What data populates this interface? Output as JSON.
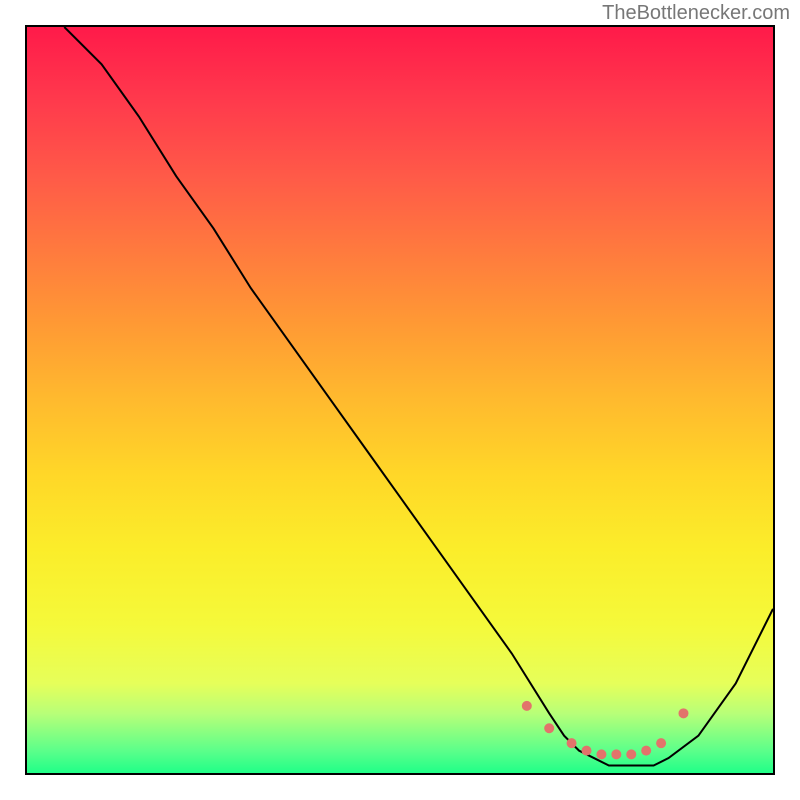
{
  "attribution": "TheBottlenecker.com",
  "chart_data": {
    "type": "line",
    "title": "",
    "xlabel": "",
    "ylabel": "",
    "xlim": [
      0,
      100
    ],
    "ylim": [
      0,
      100
    ],
    "series": [
      {
        "name": "bottleneck-curve",
        "x": [
          5,
          10,
          15,
          20,
          25,
          30,
          35,
          40,
          45,
          50,
          55,
          60,
          65,
          70,
          72,
          74,
          76,
          78,
          80,
          82,
          84,
          86,
          90,
          95,
          100
        ],
        "y": [
          100,
          95,
          88,
          80,
          73,
          65,
          58,
          51,
          44,
          37,
          30,
          23,
          16,
          8,
          5,
          3,
          2,
          1,
          1,
          1,
          1,
          2,
          5,
          12,
          22
        ]
      }
    ],
    "markers": {
      "name": "optimal-range-dots",
      "x": [
        67,
        70,
        73,
        75,
        77,
        79,
        81,
        83,
        85,
        88
      ],
      "y": [
        9,
        6,
        4,
        3,
        2.5,
        2.5,
        2.5,
        3,
        4,
        8
      ]
    },
    "gradient_bands": [
      "#ff1a4a",
      "#ffba2e",
      "#f5f93a",
      "#20ff88"
    ]
  }
}
